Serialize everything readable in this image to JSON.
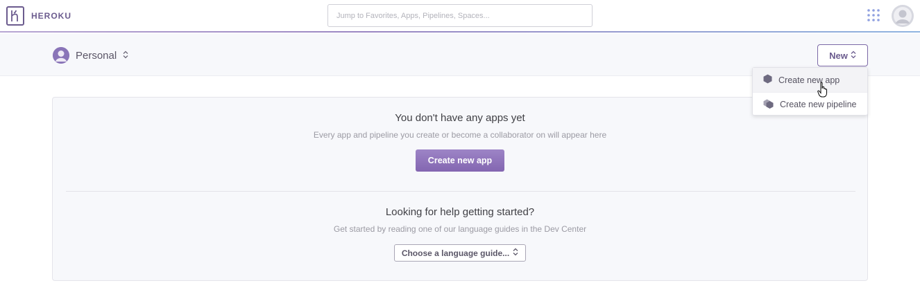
{
  "topnav": {
    "logo_text": "HEROKU",
    "search_placeholder": "Jump to Favorites, Apps, Pipelines, Spaces..."
  },
  "subheader": {
    "account_label": "Personal",
    "new_button_label": "New"
  },
  "dropdown": {
    "items": [
      {
        "label": "Create new app",
        "icon": "app-hexagon-icon"
      },
      {
        "label": "Create new pipeline",
        "icon": "pipeline-hexagons-icon"
      }
    ]
  },
  "main": {
    "empty_title": "You don't have any apps yet",
    "empty_subtitle": "Every app and pipeline you create or become a collaborator on will appear here",
    "create_button": "Create new app",
    "help_title": "Looking for help getting started?",
    "help_subtitle": "Get started by reading one of our language guides in the Dev Center",
    "language_select": "Choose a language guide..."
  },
  "colors": {
    "brand": "#6b5b8e",
    "primary_button": "#8a6fb8",
    "card_bg": "#f7f8fb"
  }
}
